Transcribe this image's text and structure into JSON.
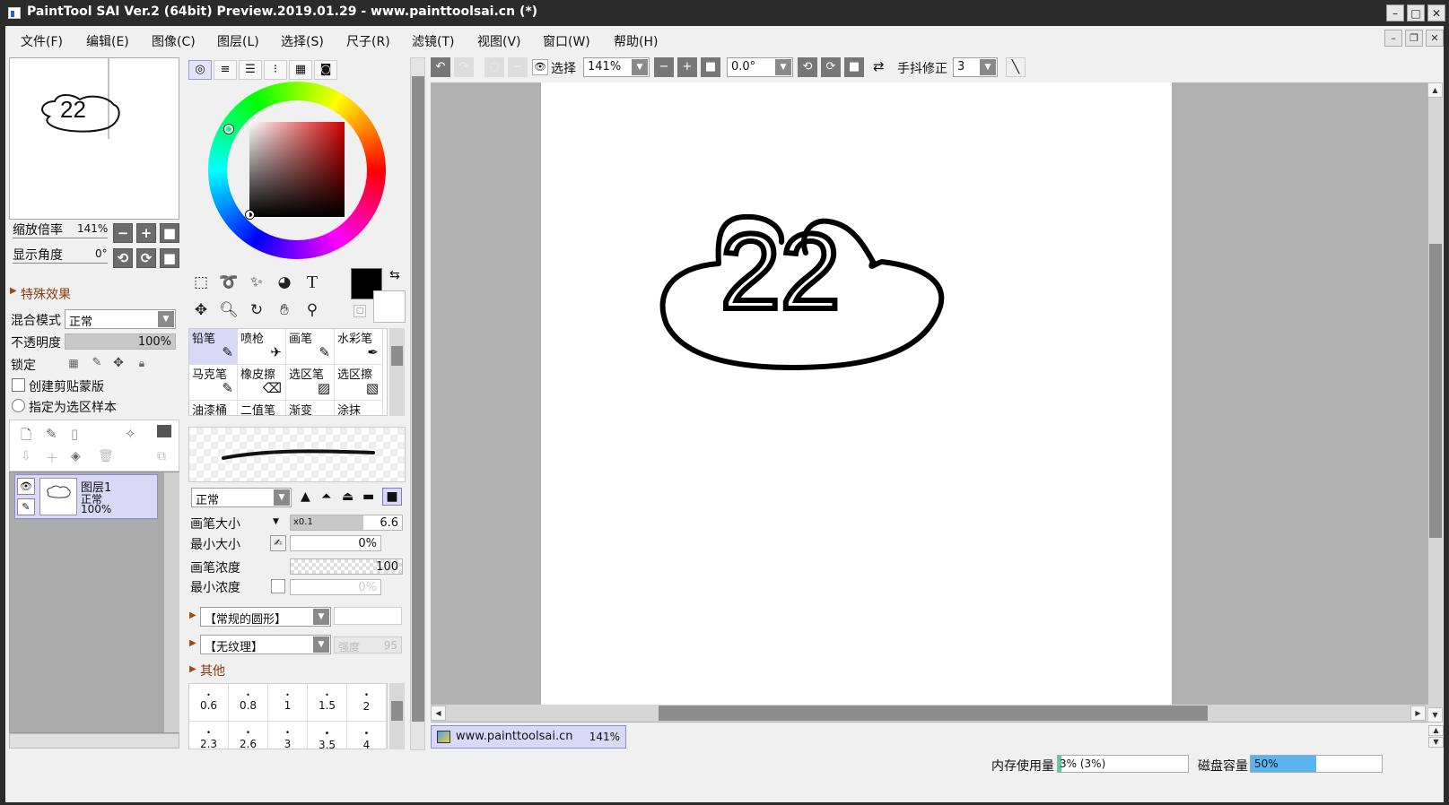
{
  "window": {
    "title": "PaintTool SAI Ver.2 (64bit) Preview.2019.01.29 - www.painttoolsai.cn (*)",
    "controls": {
      "minimize": "–",
      "maximize": "□",
      "close": "✕"
    }
  },
  "menu": [
    "文件(F)",
    "编辑(E)",
    "图像(C)",
    "图层(L)",
    "选择(S)",
    "尺子(R)",
    "滤镜(T)",
    "视图(V)",
    "窗口(W)",
    "帮助(H)"
  ],
  "navigator": {
    "zoom_label": "缩放倍率",
    "zoom_value": "141%",
    "angle_label": "显示角度",
    "angle_value": "0°"
  },
  "layer_panel": {
    "special_effects": "特殊效果",
    "blend_label": "混合模式",
    "blend_value": "正常",
    "opacity_label": "不透明度",
    "opacity_value": "100%",
    "opacity_fraction": 1.0,
    "lock_label": "锁定",
    "clip_label": "创建剪贴蒙版",
    "sample_label": "指定为选区样本",
    "layers": [
      {
        "name": "图层1",
        "mode": "正常",
        "opacity": "100%"
      }
    ]
  },
  "tools": {
    "brushes_row1": [
      "铅笔",
      "喷枪",
      "画笔",
      "水彩笔"
    ],
    "brushes_row2": [
      "马克笔",
      "橡皮擦",
      "选区笔",
      "选区擦"
    ],
    "brushes_row3": [
      "油漆桶",
      "二值笔",
      "渐变",
      "涂抹"
    ],
    "brush_mode": "正常",
    "size_label": "画笔大小",
    "size_multiplier": "x0.1",
    "size_value": "6.6",
    "min_size_label": "最小大小",
    "min_size_value": "0%",
    "density_label": "画笔浓度",
    "density_value": "100",
    "min_density_label": "最小浓度",
    "min_density_value": "0%",
    "shape_value": "【常规的圆形】",
    "texture_value": "【无纹理】",
    "texture_strength_label": "强度",
    "texture_strength_value": "95",
    "other_label": "其他",
    "dot_sizes_row1": [
      "0.6",
      "0.8",
      "1",
      "1.5",
      "2"
    ],
    "dot_sizes_row2": [
      "2.3",
      "2.6",
      "3",
      "3.5",
      "4"
    ]
  },
  "toolbar": {
    "select_label": "选择",
    "zoom_value": "141%",
    "angle_value": "0.0°",
    "stabilizer_label": "手抖修正",
    "stabilizer_value": "3"
  },
  "canvas": {
    "drawing_text": "22",
    "tab_name": "www.painttoolsai.cn",
    "tab_zoom": "141%"
  },
  "status": {
    "memory_label": "内存使用量",
    "memory_value": "3% (3%)",
    "memory_fraction": 0.03,
    "disk_label": "磁盘容量",
    "disk_value": "50%",
    "disk_fraction": 0.5
  },
  "colors": {
    "accent_selected": "#d9d9f7",
    "disk_bar": "#5ab4f0",
    "memory_bar": "#4fd1a0",
    "foreground": "#000000",
    "background": "#ffffff"
  }
}
